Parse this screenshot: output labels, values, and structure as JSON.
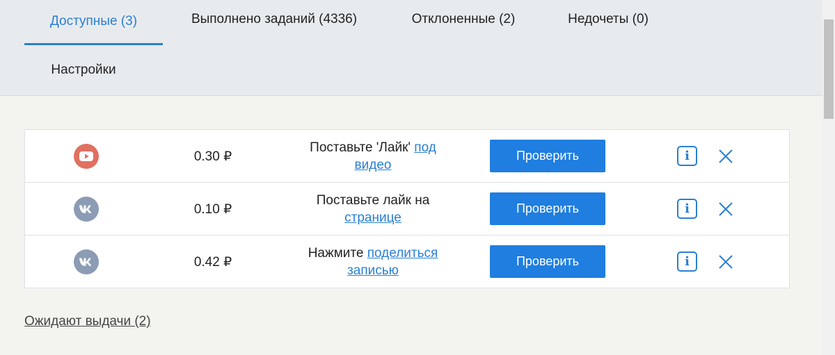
{
  "tabs": [
    {
      "label": "Доступные (3)",
      "active": true
    },
    {
      "label": "Выполнено заданий (4336)",
      "active": false
    },
    {
      "label": "Отклоненные (2)",
      "active": false
    },
    {
      "label": "Недочеты (0)",
      "active": false
    },
    {
      "label": "Настройки",
      "active": false
    }
  ],
  "tasks": [
    {
      "platform_icon": "youtube-icon",
      "price": "0.30 ₽",
      "desc_text": "Поставьте 'Лайк' ",
      "desc_link": "под видео",
      "check_label": "Проверить"
    },
    {
      "platform_icon": "vk-icon",
      "price": "0.10 ₽",
      "desc_text": "Поставьте лайк на ",
      "desc_link": "странице",
      "check_label": "Проверить"
    },
    {
      "platform_icon": "vk-icon",
      "price": "0.42 ₽",
      "desc_text": "Нажмите ",
      "desc_link": "поделиться записью",
      "check_label": "Проверить"
    }
  ],
  "info_icon": "info-icon",
  "close_icon": "close-icon",
  "pending_link": "Ожидают выдачи (2)",
  "colors": {
    "accent": "#2a7fd4",
    "button": "#1f7ee0",
    "youtube": "#e07060",
    "vk": "#8b9cb4"
  }
}
